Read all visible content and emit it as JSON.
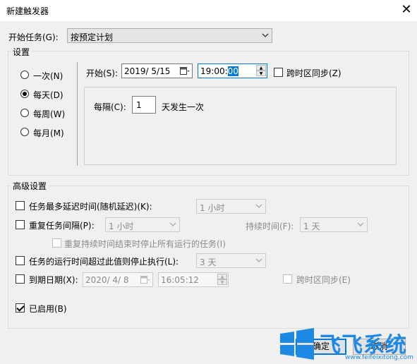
{
  "window": {
    "title": "新建触发器",
    "close_glyph": "✕"
  },
  "begin_task": {
    "label": "开始任务(G):",
    "value": "按预定计划"
  },
  "settings": {
    "title": "设置",
    "radios": [
      {
        "label": "一次(N)",
        "checked": false
      },
      {
        "label": "每天(D)",
        "checked": true
      },
      {
        "label": "每周(W)",
        "checked": false
      },
      {
        "label": "每月(M)",
        "checked": false
      }
    ],
    "start_label": "开始(S):",
    "start_date": "2019/ 5/15",
    "start_time_prefix": "19:00:",
    "start_time_selected": "00",
    "sync_label": "跨时区同步(Z)",
    "recur_label": "每隔(C):",
    "recur_value": "1",
    "recur_suffix": "天发生一次"
  },
  "advanced": {
    "title": "高级设置",
    "delay_label": "任务最多延迟时间(随机延迟)(K):",
    "delay_value": "1 小时",
    "repeat_label": "重复任务间隔(P):",
    "repeat_value": "1 小时",
    "duration_label": "持续时间(F):",
    "duration_value": "1 天",
    "stop_running_label": "重复持续时间结束时停止所有运行的任务(I)",
    "stop_longer_label": "任务的运行时间超过此值则停止执行(L):",
    "stop_longer_value": "3 天",
    "expire_label": "到期日期(X):",
    "expire_date": "2020/ 4/ 8",
    "expire_time": "16:05:12",
    "expire_sync_label": "跨时区同步(E)",
    "enabled_label": "已启用(B)"
  },
  "buttons": {
    "ok": "确定",
    "cancel": "取消"
  },
  "watermark": {
    "brand": "飞飞系统",
    "url": "www.feifeixitong.com"
  }
}
